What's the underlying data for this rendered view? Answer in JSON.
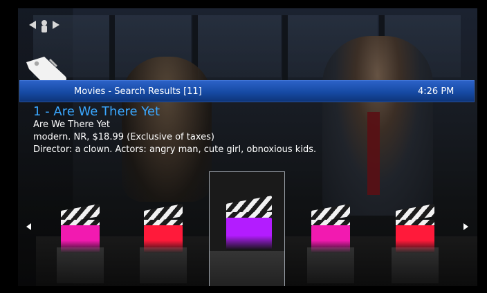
{
  "header": {
    "title": "Movies - Search Results [11]",
    "time": "4:26 PM"
  },
  "selected_item": {
    "title": "1 - Are We There Yet",
    "subtitle": "Are We There Yet",
    "meta": "modern. NR, $18.99 (Exclusive of taxes)",
    "credits": "Director: a clown. Actors: angry man, cute girl, obnoxious kids."
  },
  "icons": {
    "top": "speaker-icon",
    "left_section": "tag-icon",
    "nav_left": "triangle-left-icon",
    "nav_right": "triangle-right-icon",
    "clapperboard": "clapperboard-icon"
  },
  "carousel": {
    "items": [
      {
        "color": "#f21ab0"
      },
      {
        "color": "#ff1a3a"
      },
      {
        "color": "#b31cff"
      },
      {
        "color": "#f21ab0"
      },
      {
        "color": "#ff1a3a"
      }
    ],
    "selected_index": 2
  }
}
